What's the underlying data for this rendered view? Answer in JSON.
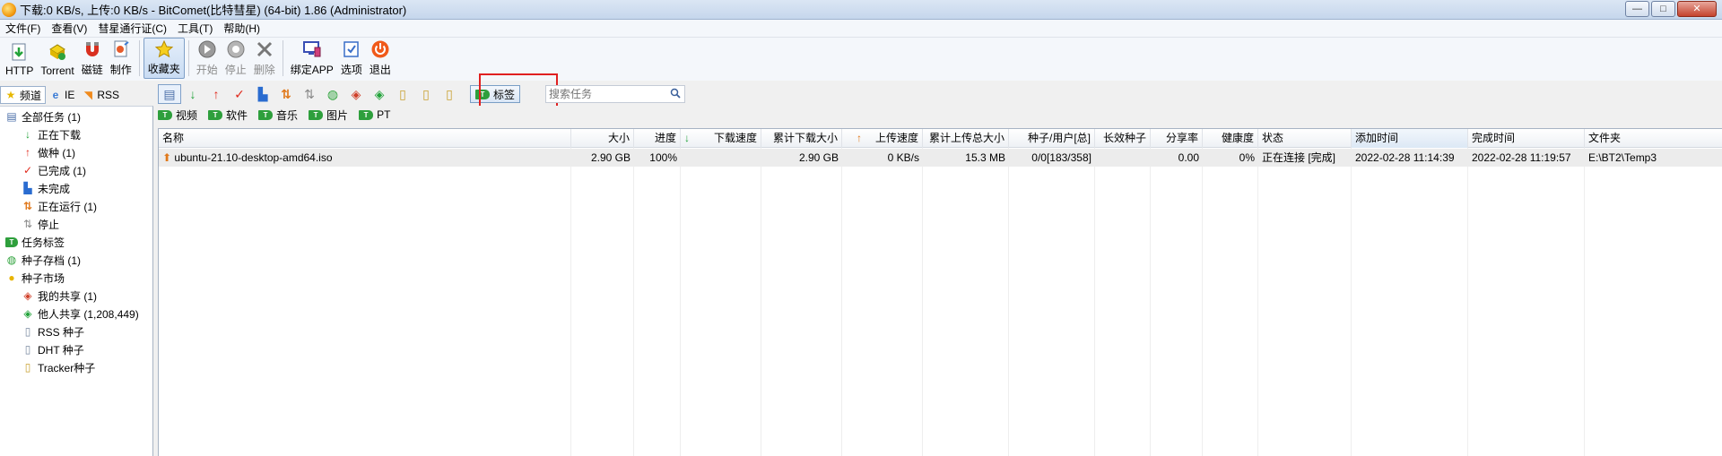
{
  "window": {
    "title": "下载:0 KB/s, 上传:0 KB/s - BitComet(比特彗星) (64-bit) 1.86 (Administrator)",
    "min_label": "—",
    "max_label": "□",
    "close_label": "✕"
  },
  "menu": [
    "文件(F)",
    "查看(V)",
    "彗星通行证(C)",
    "工具(T)",
    "帮助(H)"
  ],
  "toolbar": {
    "http": "HTTP",
    "torrent": "Torrent",
    "magnet": "磁链",
    "make": "制作",
    "favorites": "收藏夹",
    "start": "开始",
    "stop": "停止",
    "delete": "删除",
    "bind_app": "绑定APP",
    "options": "选项",
    "exit": "退出"
  },
  "left_tabs": [
    "频道",
    "IE",
    "RSS"
  ],
  "tree": {
    "all_tasks": "全部任务 (1)",
    "downloading": "正在下载",
    "seeding": "做种 (1)",
    "completed": "已完成 (1)",
    "incomplete": "未完成",
    "running": "正在运行 (1)",
    "stopped": "停止",
    "task_tags": "任务标签",
    "torrent_archive": "种子存档 (1)",
    "torrent_market": "种子市场",
    "my_shares": "我的共享 (1)",
    "others_shares": "他人共享 (1,208,449)",
    "rss_torrents": "RSS 种子",
    "dht_torrents": "DHT 种子",
    "tracker_torrents": "Tracker种子"
  },
  "task_toolbar": {
    "tag_label": "标签",
    "search_placeholder": "搜索任务"
  },
  "categories": [
    "视频",
    "软件",
    "音乐",
    "图片",
    "PT"
  ],
  "table": {
    "columns": {
      "name": "名称",
      "size": "大小",
      "progress": "进度",
      "down_speed": "下载速度",
      "total_down": "累计下载大小",
      "up_speed": "上传速度",
      "total_up": "累计上传总大小",
      "seeds": "种子/用户[总]",
      "valid_seeds": "长效种子",
      "ratio": "分享率",
      "health": "健康度",
      "status": "状态",
      "added": "添加时间",
      "completed": "完成时间",
      "folder": "文件夹"
    },
    "rows": [
      {
        "name": "ubuntu-21.10-desktop-amd64.iso",
        "size": "2.90 GB",
        "progress": "100%",
        "down_speed": "",
        "total_down": "2.90 GB",
        "up_speed": "0 KB/s",
        "total_up": "15.3 MB",
        "seeds": "0/0[183/358]",
        "valid_seeds": "",
        "ratio": "0.00",
        "health": "0%",
        "status": "正在连接 [完成]",
        "added": "2022-02-28 11:14:39",
        "completed": "2022-02-28 11:19:57",
        "folder": "E:\\BT2\\Temp3"
      }
    ]
  },
  "colors": {
    "titlebar": "#c5d6ec",
    "highlight": "#e02020",
    "tag_green": "#2e9f3c",
    "row_bg": "#ececec"
  }
}
